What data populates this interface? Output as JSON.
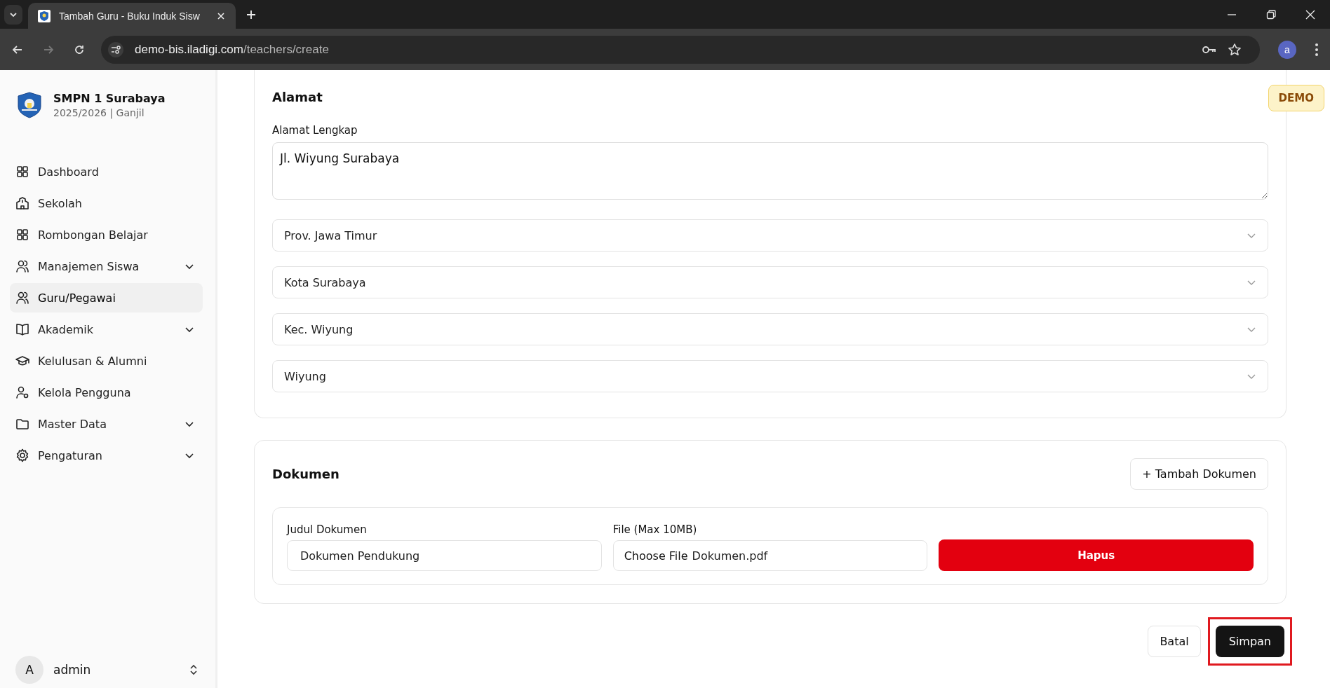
{
  "browser": {
    "tab_title": "Tambah Guru - Buku Induk Sisw",
    "url_host": "demo-bis.iladigi.com",
    "url_path": "/teachers/create",
    "profile_initial": "a"
  },
  "sidebar": {
    "school": "SMPN 1 Surabaya",
    "period": "2025/2026 | Ganjil",
    "items": [
      {
        "label": "Dashboard",
        "kind": "grid",
        "selected": false,
        "expandable": false
      },
      {
        "label": "Sekolah",
        "kind": "school",
        "selected": false,
        "expandable": false
      },
      {
        "label": "Rombongan Belajar",
        "kind": "grid",
        "selected": false,
        "expandable": false
      },
      {
        "label": "Manajemen Siswa",
        "kind": "users",
        "selected": false,
        "expandable": true
      },
      {
        "label": "Guru/Pegawai",
        "kind": "users",
        "selected": true,
        "expandable": false
      },
      {
        "label": "Akademik",
        "kind": "book",
        "selected": false,
        "expandable": true
      },
      {
        "label": "Kelulusan & Alumni",
        "kind": "cap",
        "selected": false,
        "expandable": false
      },
      {
        "label": "Kelola Pengguna",
        "kind": "usergear",
        "selected": false,
        "expandable": false
      },
      {
        "label": "Master Data",
        "kind": "folder",
        "selected": false,
        "expandable": true
      },
      {
        "label": "Pengaturan",
        "kind": "gear",
        "selected": false,
        "expandable": true
      }
    ],
    "user": {
      "initial": "A",
      "name": "admin"
    }
  },
  "badge": "DEMO",
  "address_section": {
    "title": "Alamat",
    "label": "Alamat Lengkap",
    "value": "Jl. Wiyung Surabaya",
    "selects": [
      "Prov. Jawa Timur",
      "Kota Surabaya",
      "Kec. Wiyung",
      "Wiyung"
    ]
  },
  "documents_section": {
    "title": "Dokumen",
    "add_button": "+ Tambah Dokumen",
    "rows": [
      {
        "title_label": "Judul Dokumen",
        "title_value": "Dokumen Pendukung",
        "file_label": "File (Max 10MB)",
        "file_button": "Choose File",
        "file_name": "Dokumen.pdf",
        "delete_button": "Hapus"
      }
    ]
  },
  "actions": [
    {
      "label": "Batal",
      "kind": "secondary",
      "highlighted": false
    },
    {
      "label": "Simpan",
      "kind": "primary",
      "highlighted": true
    }
  ]
}
